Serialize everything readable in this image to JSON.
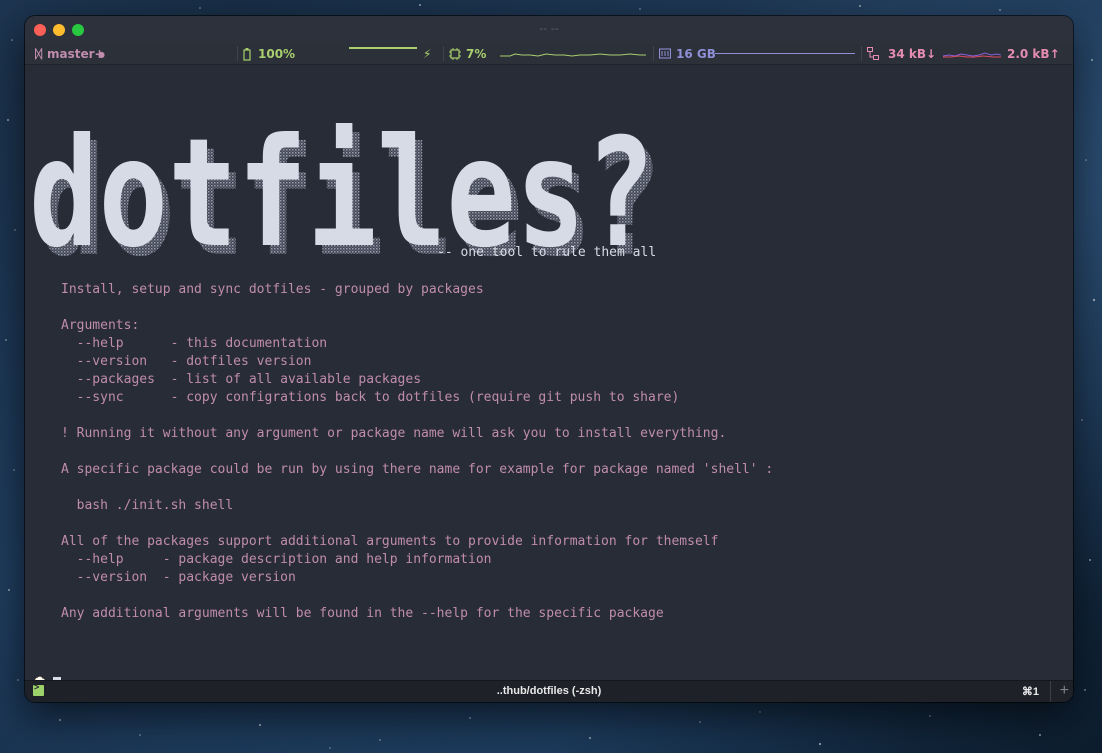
{
  "window": {
    "title": "-- --"
  },
  "statusbar": {
    "git_branch": "master+",
    "git_dot": "●",
    "battery": "100%",
    "battery_level": 1.0,
    "cpu": "7%",
    "memory": "16 GB",
    "net_down": "34 kB↓",
    "net_up": "2.0 kB↑",
    "colors": {
      "git": "#c08cad",
      "battery": "#a9cf6e",
      "cpu": "#a9cf6e",
      "memory": "#8f8fd6",
      "network": "#e58cb3"
    },
    "icons": [
      "git-branch-icon",
      "battery-icon",
      "bolt-icon",
      "cpu-icon",
      "memory-icon",
      "network-icon"
    ]
  },
  "terminal": {
    "banner_text": "dotfiles?",
    "tagline": "-- one tool to rule them all",
    "lines": [
      "Install, setup and sync dotfiles - grouped by packages",
      "",
      "Arguments:",
      "  --help      - this documentation",
      "  --version   - dotfiles version",
      "  --packages  - list of all available packages",
      "  --sync      - copy configrations back to dotfiles (require git push to share)",
      "",
      "! Running it without any argument or package name will ask you to install everything.",
      "",
      "A specific package could be run by using there name for example for package named 'shell' :",
      "",
      "  bash ./init.sh shell",
      "",
      "All of the packages support additional arguments to provide information for themself",
      "  --help     - package description and help information",
      "  --version  - package version",
      "",
      "Any additional arguments will be found in the --help for the specific package"
    ],
    "prompt_icon": "🍺",
    "colors": {
      "text": "#c08cad",
      "banner": "#d6dbe5",
      "background": "#272c36"
    }
  },
  "tabbar": {
    "title": "..thub/dotfiles (-zsh)",
    "shortcut": "⌘1",
    "add": "+"
  }
}
